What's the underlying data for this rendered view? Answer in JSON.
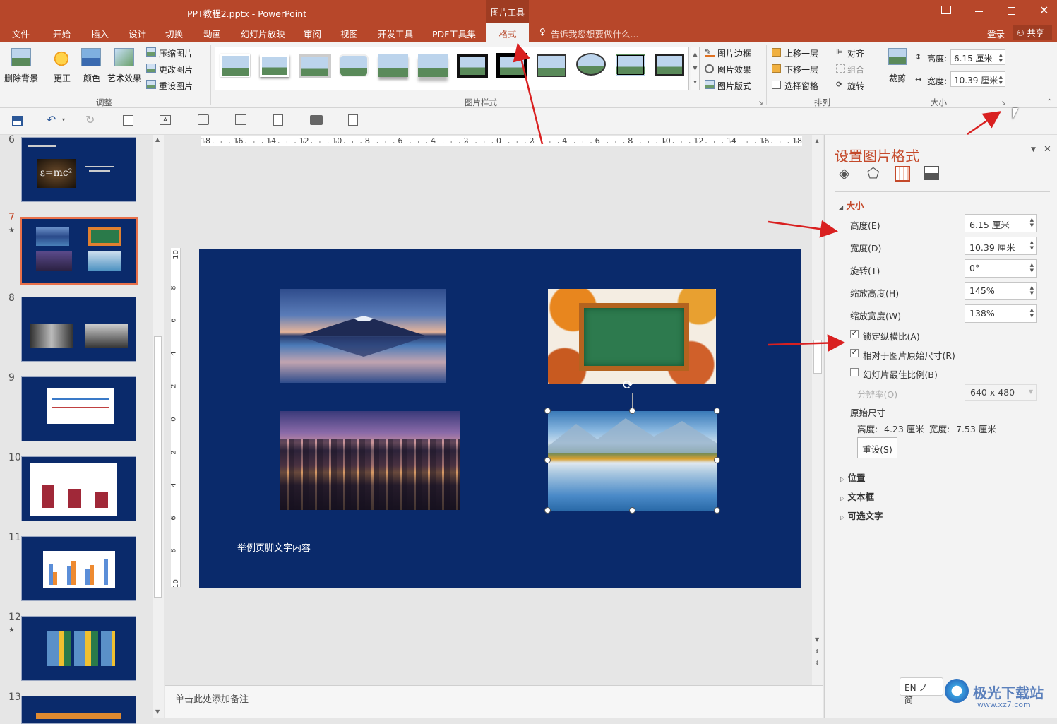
{
  "window": {
    "title": "PPT教程2.pptx - PowerPoint",
    "context_tab": "图片工具"
  },
  "menu": {
    "items": [
      "文件",
      "开始",
      "插入",
      "设计",
      "切换",
      "动画",
      "幻灯片放映",
      "审阅",
      "视图",
      "开发工具",
      "PDF工具集",
      "格式"
    ],
    "active": "格式",
    "tell_me": "告诉我您想要做什么...",
    "login": "登录",
    "share": "共享"
  },
  "ribbon": {
    "remove_bg": "删除背景",
    "correct": "更正",
    "color": "颜色",
    "art_effects": "艺术效果",
    "compress": "压缩图片",
    "change": "更改图片",
    "reset": "重设图片",
    "group_adjust": "调整",
    "group_styles": "图片样式",
    "pic_border": "图片边框",
    "pic_effect": "图片效果",
    "pic_layout": "图片版式",
    "bring_forward": "上移一层",
    "send_backward": "下移一层",
    "selection_pane": "选择窗格",
    "align": "对齐",
    "group": "组合",
    "rotate": "旋转",
    "group_arrange": "排列",
    "crop": "裁剪",
    "height_label": "高度:",
    "height_value": "6.15 厘米",
    "width_label": "宽度:",
    "width_value": "10.39 厘米",
    "group_size": "大小"
  },
  "ruler": {
    "labels": [
      "18",
      "16",
      "14",
      "12",
      "10",
      "8",
      "6",
      "4",
      "2",
      "0",
      "2",
      "4",
      "6",
      "8",
      "10",
      "12",
      "14",
      "16",
      "18"
    ],
    "vlabels": [
      "10",
      "8",
      "6",
      "4",
      "2",
      "0",
      "2",
      "4",
      "6",
      "8",
      "10"
    ]
  },
  "thumbnails": [
    {
      "num": "6",
      "star": ""
    },
    {
      "num": "7",
      "star": "★"
    },
    {
      "num": "8",
      "star": ""
    },
    {
      "num": "9",
      "star": ""
    },
    {
      "num": "10",
      "star": ""
    },
    {
      "num": "11",
      "star": ""
    },
    {
      "num": "12",
      "star": "★"
    },
    {
      "num": "13",
      "star": ""
    }
  ],
  "slide": {
    "footer": "举例页脚文字内容"
  },
  "notes": {
    "placeholder": "单击此处添加备注"
  },
  "pane": {
    "title": "设置图片格式",
    "section_size": "大小",
    "height_label": "高度(E)",
    "height_value": "6.15 厘米",
    "width_label": "宽度(D)",
    "width_value": "10.39 厘米",
    "rotate_label": "旋转(T)",
    "rotate_value": "0°",
    "scale_h_label": "缩放高度(H)",
    "scale_h_value": "145%",
    "scale_w_label": "缩放宽度(W)",
    "scale_w_value": "138%",
    "lock_ratio": "锁定纵横比(A)",
    "lock_ratio_checked": true,
    "relative": "相对于图片原始尺寸(R)",
    "relative_checked": true,
    "best_scale": "幻灯片最佳比例(B)",
    "best_scale_checked": false,
    "resolution_label": "分辨率(O)",
    "resolution_value": "640 x 480",
    "original_size": "原始尺寸",
    "orig_height_label": "高度:",
    "orig_height": "4.23 厘米",
    "orig_width_label": "宽度:",
    "orig_width": "7.53 厘米",
    "reset_button": "重设(S)",
    "section_position": "位置",
    "section_textbox": "文本框",
    "section_alt_text": "可选文字"
  },
  "ime": {
    "label": "EN ノ 简"
  },
  "watermark": {
    "text": "极光下载站",
    "url": "www.xz7.com"
  },
  "colors": {
    "brand": "#b7472a",
    "slide_bg": "#0a2a6b",
    "accent_red": "#c43a2a"
  }
}
